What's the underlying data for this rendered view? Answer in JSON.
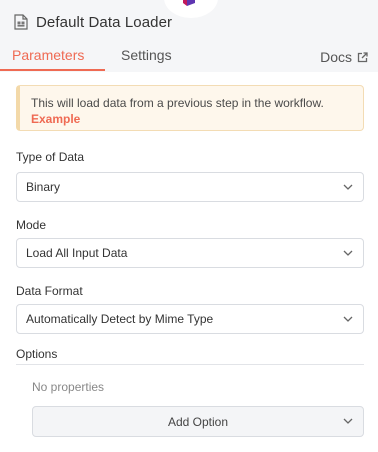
{
  "node": {
    "title": "Default Data Loader",
    "icon": "document-icon"
  },
  "tabs": {
    "parameters": "Parameters",
    "settings": "Settings",
    "docs": "Docs",
    "active_color": "#ef6a53"
  },
  "notice": {
    "text": "This will load data from a previous step in the workflow.",
    "link": "Example"
  },
  "fields": {
    "type_of_data": {
      "label": "Type of Data",
      "value": "Binary"
    },
    "mode": {
      "label": "Mode",
      "value": "Load All Input Data"
    },
    "data_format": {
      "label": "Data Format",
      "value": "Automatically Detect by Mime Type"
    }
  },
  "options": {
    "label": "Options",
    "empty_text": "No properties",
    "add_button": "Add Option"
  }
}
